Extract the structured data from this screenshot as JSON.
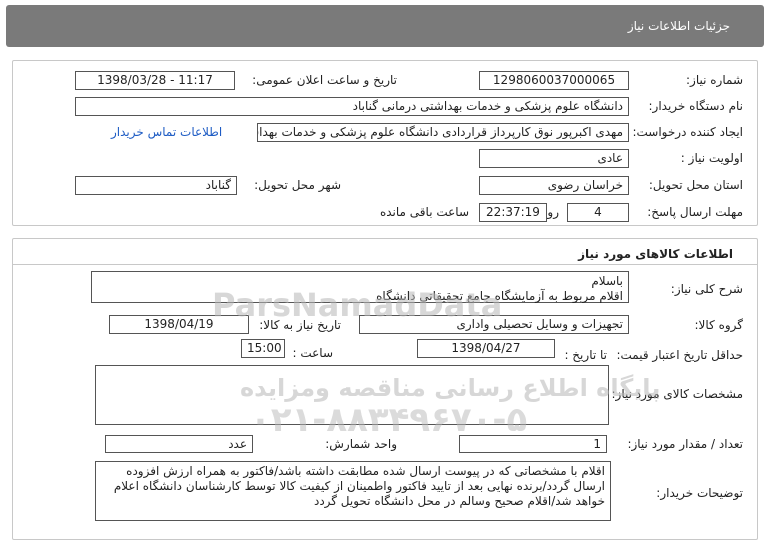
{
  "window_title": "جزئیات اطلاعات نیاز",
  "need_info": {
    "need_number_label": "شماره نیاز:",
    "need_number": "1298060037000065",
    "announce_label": "تاریخ و ساعت اعلان عمومی:",
    "announce_value": "1398/03/28 - 11:17",
    "buyer_org_label": "نام دستگاه خریدار:",
    "buyer_org": "دانشگاه علوم پزشکی و خدمات بهداشتی درمانی گناباد",
    "requester_label": "ایجاد کننده درخواست:",
    "requester": "مهدی اکبرپور نوق کارپرداز قراردادی دانشگاه علوم پزشکی و خدمات بهداشتی د",
    "contact_link": "اطلاعات تماس خریدار",
    "priority_label": "اولویت نیاز :",
    "priority": "عادی",
    "province_label": "استان محل تحویل:",
    "province": "خراسان رضوی",
    "city_label": "شهر محل تحویل:",
    "city": "گناباد",
    "deadline_label": "مهلت ارسال پاسخ:",
    "days_value": "4",
    "days_label": "روز و",
    "time_value": "22:37:19",
    "time_suffix": "ساعت باقی مانده"
  },
  "goods_info": {
    "section_title": "اطلاعات کالاهای مورد نیاز",
    "summary_label": "شرح کلی نیاز:",
    "summary_line1": "باسلام",
    "summary_line2": "اقلام مربوط به آزمایشگاه جامع تحقیقاتی دانشگاه",
    "group_label": "گروه کالا:",
    "group_value": "تجهیزات و وسایل تحصیلی واداری",
    "need_date_label": "تاریخ نیاز به کالا:",
    "need_date": "1398/04/19",
    "validity_label": "حداقل تاریخ اعتبار قیمت:",
    "until_date_label": "تا تاریخ :",
    "until_date": "1398/04/27",
    "hour_label": "ساعت :",
    "hour_value": "15:00",
    "specs_label": "مشخصات کالای مورد نیاز:",
    "specs_value": "",
    "qty_label": "تعداد / مقدار مورد نیاز:",
    "qty_value": "1",
    "unit_label": "واحد شمارش:",
    "unit_value": "عدد",
    "notes_label": "توضیحات خریدار:",
    "notes_line1": "اقلام با مشخصاتی که در پیوست ارسال شده مطابقت داشته باشد/فاکتور به همراه ارزش افزوده",
    "notes_line2": "ارسال گردد/برنده نهایی بعد از تایید فاکتور واطمینان از کیفیت کالا توسط کارشناسان دانشگاه اعلام",
    "notes_line3": "خواهد شد/اقلام صحیح وسالم در محل دانشگاه تحویل گردد"
  },
  "watermark": {
    "brand_latin": "ParsNamadData",
    "brand_fa": "پایگاه اطلاع رسانی مناقصه ومزایده",
    "phone": "۰۲۱-۸۸۳۴۹۶۷۰-۵"
  }
}
